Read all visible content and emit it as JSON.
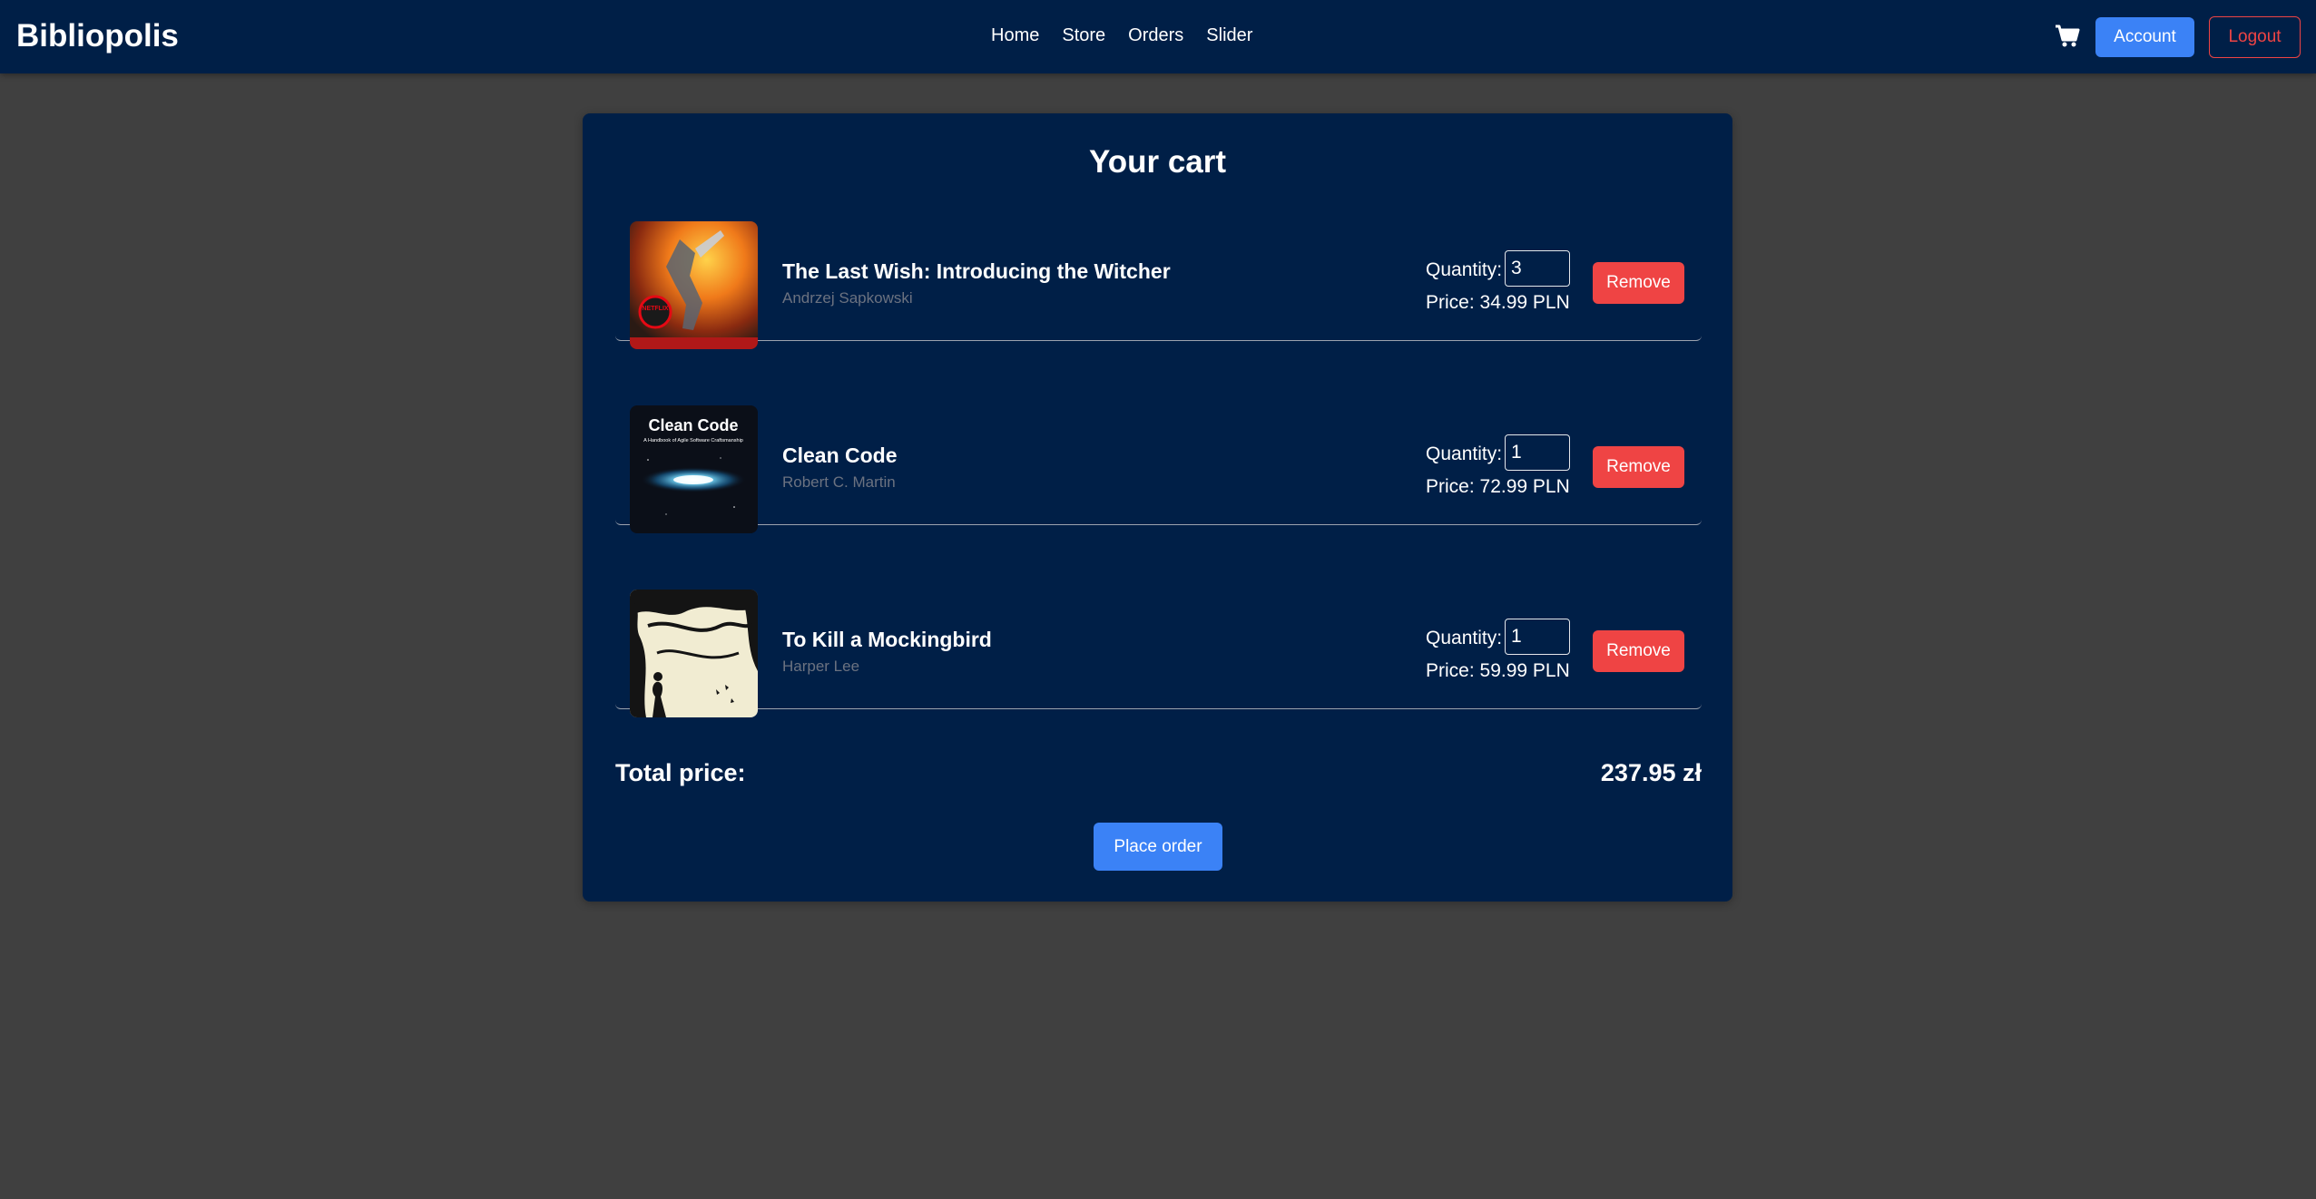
{
  "navbar": {
    "brand": "Bibliopolis",
    "links": [
      "Home",
      "Store",
      "Orders",
      "Slider"
    ],
    "cart_icon": "shopping-cart-icon",
    "account_label": "Account",
    "logout_label": "Logout"
  },
  "cart": {
    "title": "Your cart",
    "quantity_label": "Quantity:",
    "remove_label": "Remove",
    "items": [
      {
        "title": "The Last Wish: Introducing the Witcher",
        "author": "Andrzej Sapkowski",
        "quantity": "3",
        "price": "Price: 34.99 PLN",
        "cover_badge": "NETFLIX"
      },
      {
        "title": "Clean Code",
        "author": "Robert C. Martin",
        "quantity": "1",
        "price": "Price: 72.99 PLN",
        "cover_title": "Clean Code",
        "cover_subtitle": "A Handbook of Agile Software Craftsmanship"
      },
      {
        "title": "To Kill a Mockingbird",
        "author": "Harper Lee",
        "quantity": "1",
        "price": "Price: 59.99 PLN"
      }
    ],
    "total_label": "Total price:",
    "total_value": "237.95 zł",
    "place_order_label": "Place order"
  },
  "colors": {
    "navbar_bg": "#001f47",
    "page_bg": "#404040",
    "primary": "#3b82f6",
    "danger": "#ef4444",
    "muted_text": "#6b7280"
  }
}
